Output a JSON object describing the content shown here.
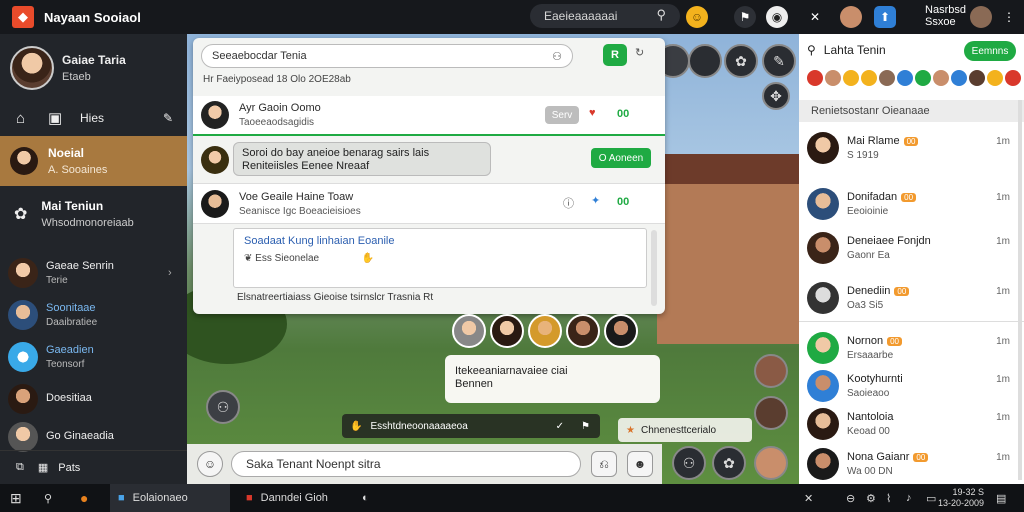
{
  "app": {
    "title": "Nayaan Sooiaol"
  },
  "topbar": {
    "search_label": "Eaeieaaaaaai"
  },
  "user": {
    "name": "Nasrbsd",
    "sub": "Ssxoe"
  },
  "profile": {
    "name": "Gaiae Taria",
    "status": "Etaeb"
  },
  "nav": {
    "files": "Hies",
    "active_label": "Noeial",
    "active_sub": "A. Sooaines",
    "game_label": "Mai Teniun",
    "game_sub": "Whsodmonoreiaab",
    "bottom": "Pats"
  },
  "contacts": [
    {
      "name": "Gaeae Senrin",
      "sub": "Terie"
    },
    {
      "name": "Soonitaae",
      "sub": "Daaibratiee"
    },
    {
      "name": "Gaeadien",
      "sub": "Teonsorf"
    },
    {
      "name": "Doesitiaa",
      "sub": ""
    },
    {
      "name": "Go Ginaeadia",
      "sub": ""
    }
  ],
  "chat": {
    "search": "Seeaebocdar Tenia",
    "meta": "Hr Faeiyposead 18 Olo 2OE28ab",
    "msg1_title": "Ayr Gaoin   Oomo",
    "msg1_sub": "Taoeeaodsagidis",
    "msg1_pill": "Serv",
    "msg1_count": "00",
    "bubble_line1": "Soroi do bay aneioe benarag sairs lais",
    "bubble_line2": "Reniteiisles Eenee Nreaaf",
    "bubble_button": "O Aoneen",
    "msg2_title": "Voe Geaile Haine Toaw",
    "msg2_sub": "Seanisce Igc Boeacieisioes",
    "msg2_count": "00",
    "card_title": "Soadaat Kung linhaian Eoanile",
    "card_row2": "Ess Sieonelae",
    "footer": "Elsnatreertiaiass Gieoise tsirnslcr Trasnia Rt"
  },
  "group_panel": {
    "line1": "Itekeeaniarnavaiee ciai",
    "line2": "Bennen"
  },
  "hud": {
    "bar": "Esshtdneoonaaaaeoa",
    "badge": "Chnenesttcerialo"
  },
  "composer": {
    "placeholder": "Saka Tenant Noenpt sitra"
  },
  "right_panel": {
    "title": "Lahta Tenin",
    "button": "Eemnns",
    "section": "Renietsostanr Oieanaae",
    "items": [
      {
        "name": "Mai Rlame",
        "sub": "S 1919",
        "time": "1m"
      },
      {
        "name": "Donifadan",
        "sub": "Eeoioinie",
        "time": "1m"
      },
      {
        "name": "Deneiaee Fonjdn",
        "sub": "Gaonr Ea",
        "time": "1m"
      },
      {
        "name": "Denediin",
        "sub": "Oa3 Si5",
        "time": "1m"
      },
      {
        "name": "Nornon",
        "sub": "Ersaaarbe",
        "time": "1m"
      },
      {
        "name": "Kootyhurnti",
        "sub": "Saoieaoo",
        "time": "1m"
      },
      {
        "name": "Nantoloia",
        "sub": "Keoad 00",
        "time": "1m"
      },
      {
        "name": "Nona Gaianr",
        "sub": "Wa 00 DN",
        "time": "1m"
      }
    ]
  },
  "taskbar": {
    "item1": "Eolaionaeo",
    "item2": "Danndei Gioh",
    "time": "19-32 S",
    "date": "13-20-2009"
  },
  "colors": {
    "accent": "#1faa43",
    "active_nav": "#a8793f",
    "dark": "#22252a"
  }
}
